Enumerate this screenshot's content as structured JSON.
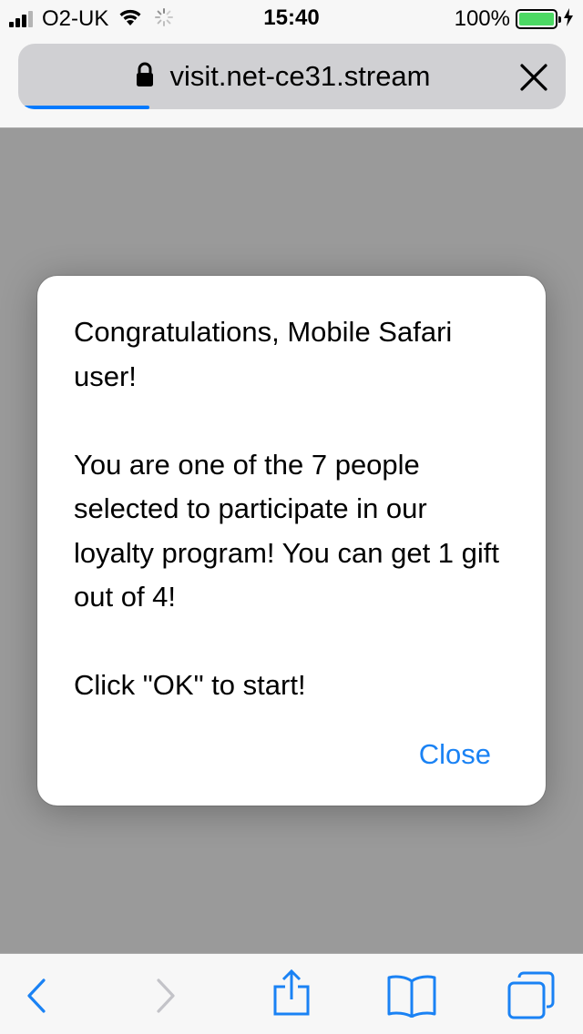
{
  "status_bar": {
    "carrier": "O2-UK",
    "time": "15:40",
    "battery_percent": "100%",
    "battery_level": 1.0,
    "signal_bars": 3,
    "signal_bars_total": 4
  },
  "browser": {
    "url": "visit.net-ce31.stream",
    "load_progress": 0.24,
    "accent_color": "#007aff"
  },
  "dialog": {
    "paragraphs": [
      "Congratulations, Mobile Safari user!",
      "You are one of the 7 people selected to participate in our loyalty program! You can get 1 gift out of 4!",
      "Click \"OK\" to start!"
    ],
    "close_label": "Close"
  },
  "toolbar": {
    "icons": [
      "back-icon",
      "forward-icon",
      "share-icon",
      "bookmarks-icon",
      "tabs-icon"
    ]
  }
}
